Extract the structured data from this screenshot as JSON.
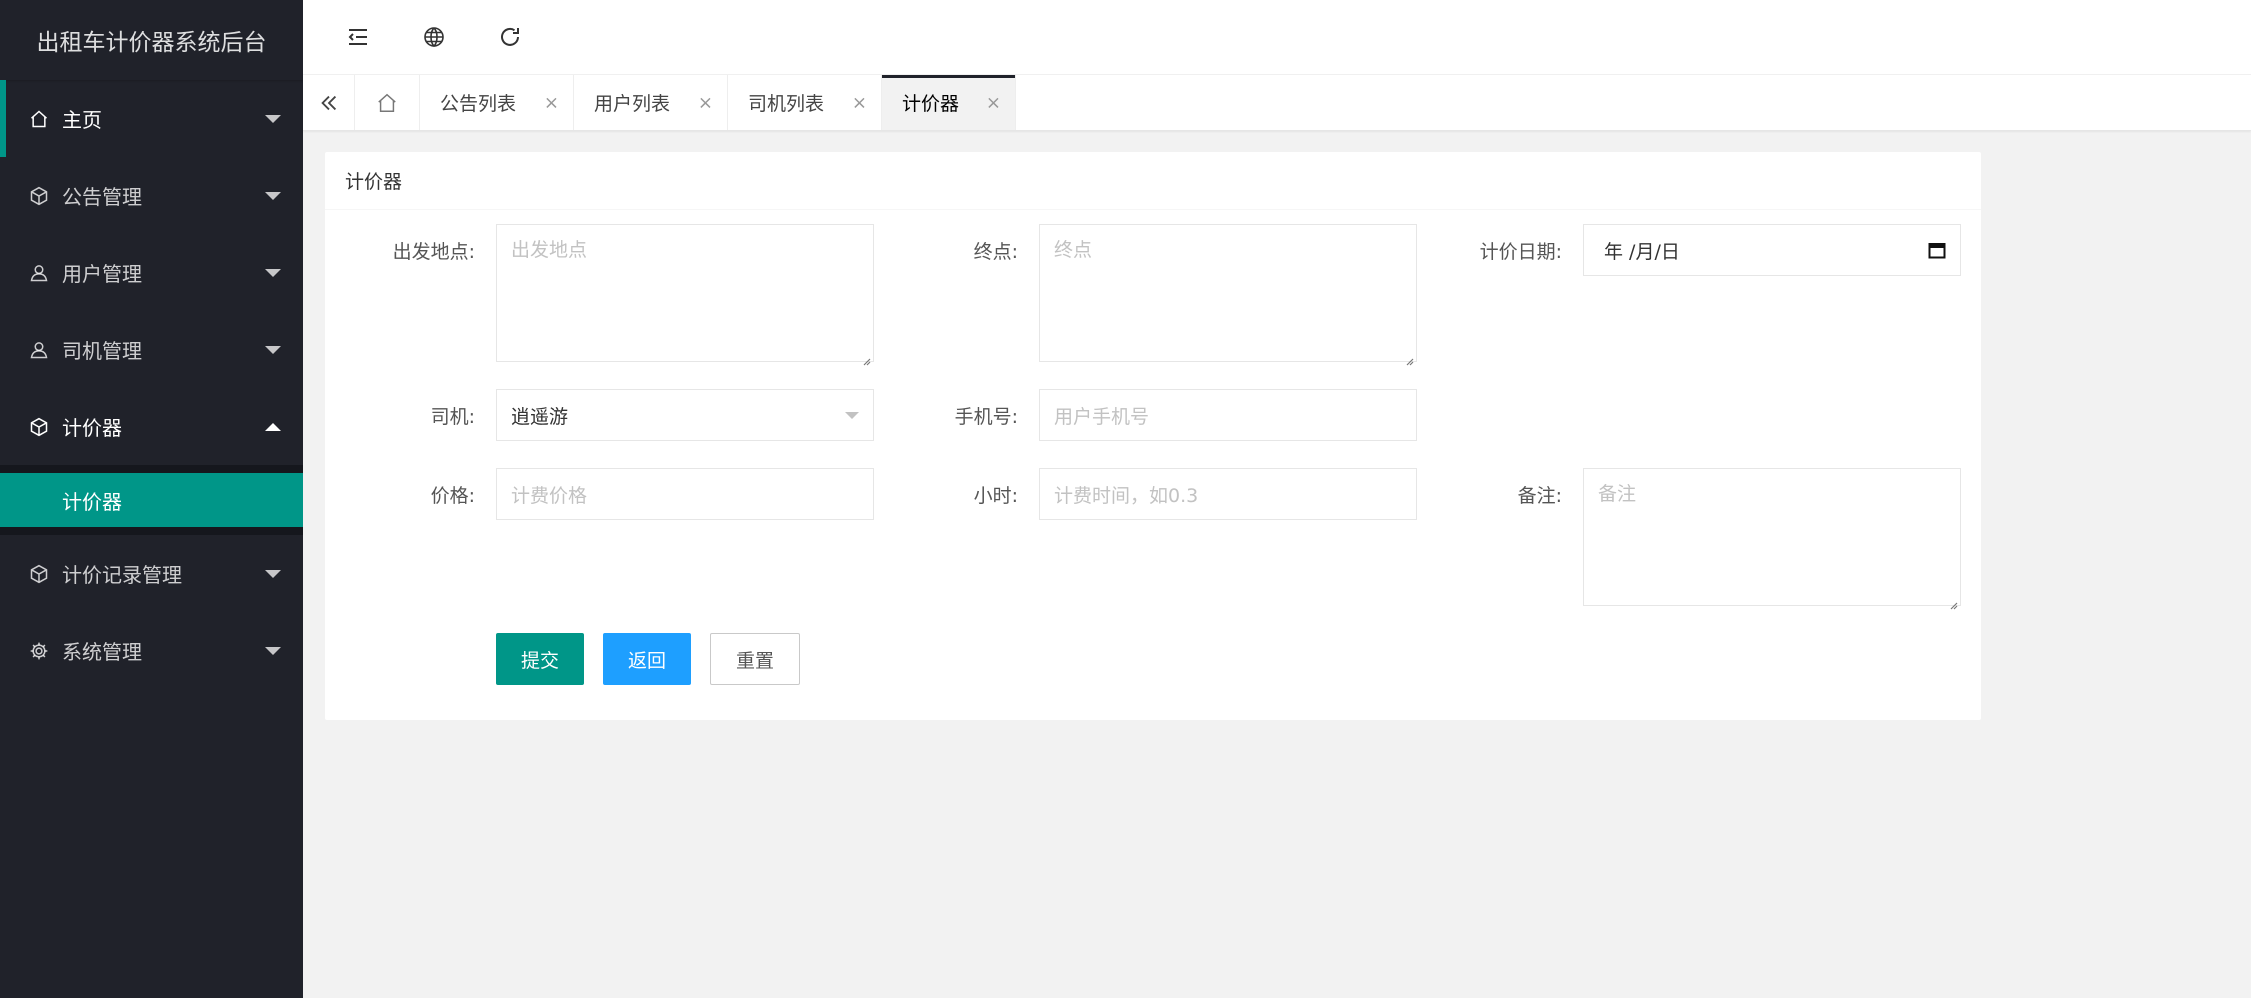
{
  "app": {
    "title": "出租车计价器系统后台"
  },
  "sidebar": {
    "items": [
      {
        "label": "主页",
        "icon": "home-icon"
      },
      {
        "label": "公告管理",
        "icon": "cube-icon"
      },
      {
        "label": "用户管理",
        "icon": "user-icon"
      },
      {
        "label": "司机管理",
        "icon": "user-icon"
      },
      {
        "label": "计价器",
        "icon": "cube-icon"
      },
      {
        "label": "计价记录管理",
        "icon": "cube-icon"
      },
      {
        "label": "系统管理",
        "icon": "gear-icon"
      }
    ],
    "submenu": {
      "label": "计价器"
    }
  },
  "header": {
    "icons": [
      "menu-fold-icon",
      "globe-icon",
      "refresh-icon"
    ]
  },
  "tabs": {
    "items": [
      {
        "label": "公告列表"
      },
      {
        "label": "用户列表"
      },
      {
        "label": "司机列表"
      },
      {
        "label": "计价器",
        "active": true
      }
    ],
    "close_glyph": "×"
  },
  "card": {
    "title": "计价器",
    "fields": {
      "start": {
        "label": "出发地点:",
        "placeholder": "出发地点"
      },
      "end": {
        "label": "终点:",
        "placeholder": "终点"
      },
      "date": {
        "label": "计价日期:",
        "value": "年 /月/日"
      },
      "driver": {
        "label": "司机:",
        "value": "逍遥游"
      },
      "phone": {
        "label": "手机号:",
        "placeholder": "用户手机号"
      },
      "price": {
        "label": "价格:",
        "placeholder": "计费价格"
      },
      "hours": {
        "label": "小时:",
        "placeholder": "计费时间，如0.3"
      },
      "remark": {
        "label": "备注:",
        "placeholder": "备注"
      }
    },
    "buttons": {
      "submit": "提交",
      "back": "返回",
      "reset": "重置"
    }
  },
  "colors": {
    "sidebar_bg": "#20222a",
    "accent": "#009688",
    "blue": "#1e9fff"
  }
}
